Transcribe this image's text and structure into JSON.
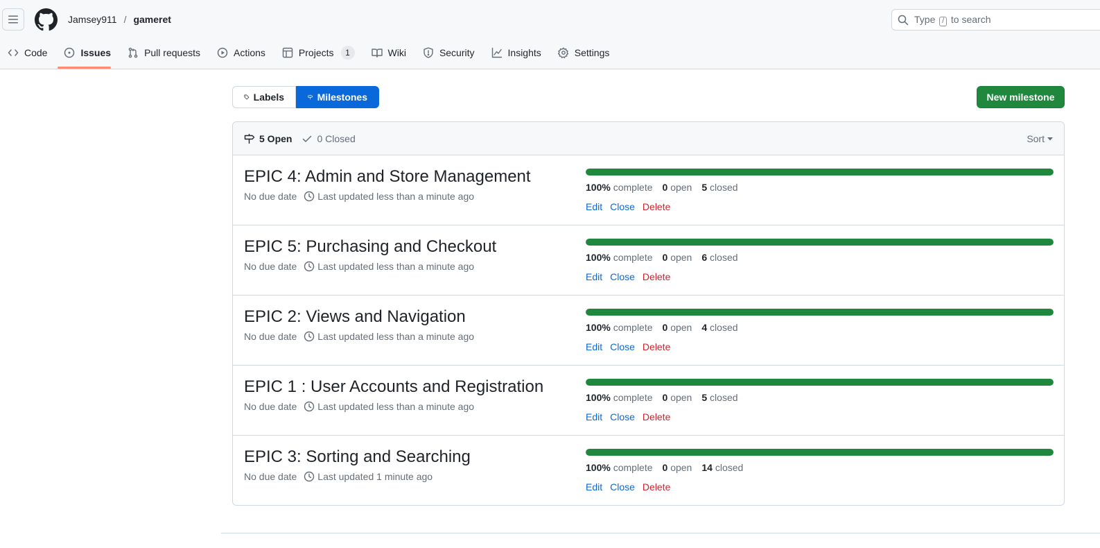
{
  "header": {
    "owner": "Jamsey911",
    "separator": "/",
    "repo": "gameret",
    "search_before": "Type",
    "search_key": "/",
    "search_after": "to search"
  },
  "nav": {
    "tabs": [
      {
        "label": "Code",
        "icon": "code-icon"
      },
      {
        "label": "Issues",
        "icon": "issue-opened-icon",
        "active": true
      },
      {
        "label": "Pull requests",
        "icon": "git-pull-request-icon"
      },
      {
        "label": "Actions",
        "icon": "play-icon"
      },
      {
        "label": "Projects",
        "icon": "table-icon",
        "count": "1"
      },
      {
        "label": "Wiki",
        "icon": "book-icon"
      },
      {
        "label": "Security",
        "icon": "shield-icon"
      },
      {
        "label": "Insights",
        "icon": "graph-icon"
      },
      {
        "label": "Settings",
        "icon": "gear-icon"
      }
    ]
  },
  "subnav": {
    "labels": "Labels",
    "milestones": "Milestones"
  },
  "new_milestone": "New milestone",
  "box_header": {
    "open_label": "5 Open",
    "closed_label": "0 Closed",
    "sort_label": "Sort"
  },
  "milestones": [
    {
      "title": "EPIC 4: Admin and Store Management",
      "due": "No due date",
      "updated": "Last updated less than a minute ago",
      "percent": "100%",
      "percent_value": 100,
      "complete_label": "complete",
      "open_count": "0",
      "open_label": "open",
      "closed_count": "5",
      "closed_label": "closed",
      "edit": "Edit",
      "close": "Close",
      "delete": "Delete"
    },
    {
      "title": "EPIC 5: Purchasing and Checkout",
      "due": "No due date",
      "updated": "Last updated less than a minute ago",
      "percent": "100%",
      "percent_value": 100,
      "complete_label": "complete",
      "open_count": "0",
      "open_label": "open",
      "closed_count": "6",
      "closed_label": "closed",
      "edit": "Edit",
      "close": "Close",
      "delete": "Delete"
    },
    {
      "title": "EPIC 2: Views and Navigation",
      "due": "No due date",
      "updated": "Last updated less than a minute ago",
      "percent": "100%",
      "percent_value": 100,
      "complete_label": "complete",
      "open_count": "0",
      "open_label": "open",
      "closed_count": "4",
      "closed_label": "closed",
      "edit": "Edit",
      "close": "Close",
      "delete": "Delete"
    },
    {
      "title": "EPIC 1 : User Accounts and Registration",
      "due": "No due date",
      "updated": "Last updated less than a minute ago",
      "percent": "100%",
      "percent_value": 100,
      "complete_label": "complete",
      "open_count": "0",
      "open_label": "open",
      "closed_count": "5",
      "closed_label": "closed",
      "edit": "Edit",
      "close": "Close",
      "delete": "Delete"
    },
    {
      "title": "EPIC 3: Sorting and Searching",
      "due": "No due date",
      "updated": "Last updated 1 minute ago",
      "percent": "100%",
      "percent_value": 100,
      "complete_label": "complete",
      "open_count": "0",
      "open_label": "open",
      "closed_count": "14",
      "closed_label": "closed",
      "edit": "Edit",
      "close": "Close",
      "delete": "Delete"
    }
  ],
  "colors": {
    "accent": "#0969da",
    "success": "#1f883d",
    "danger": "#cf222e",
    "active_tab_underline": "#fd8c73"
  }
}
